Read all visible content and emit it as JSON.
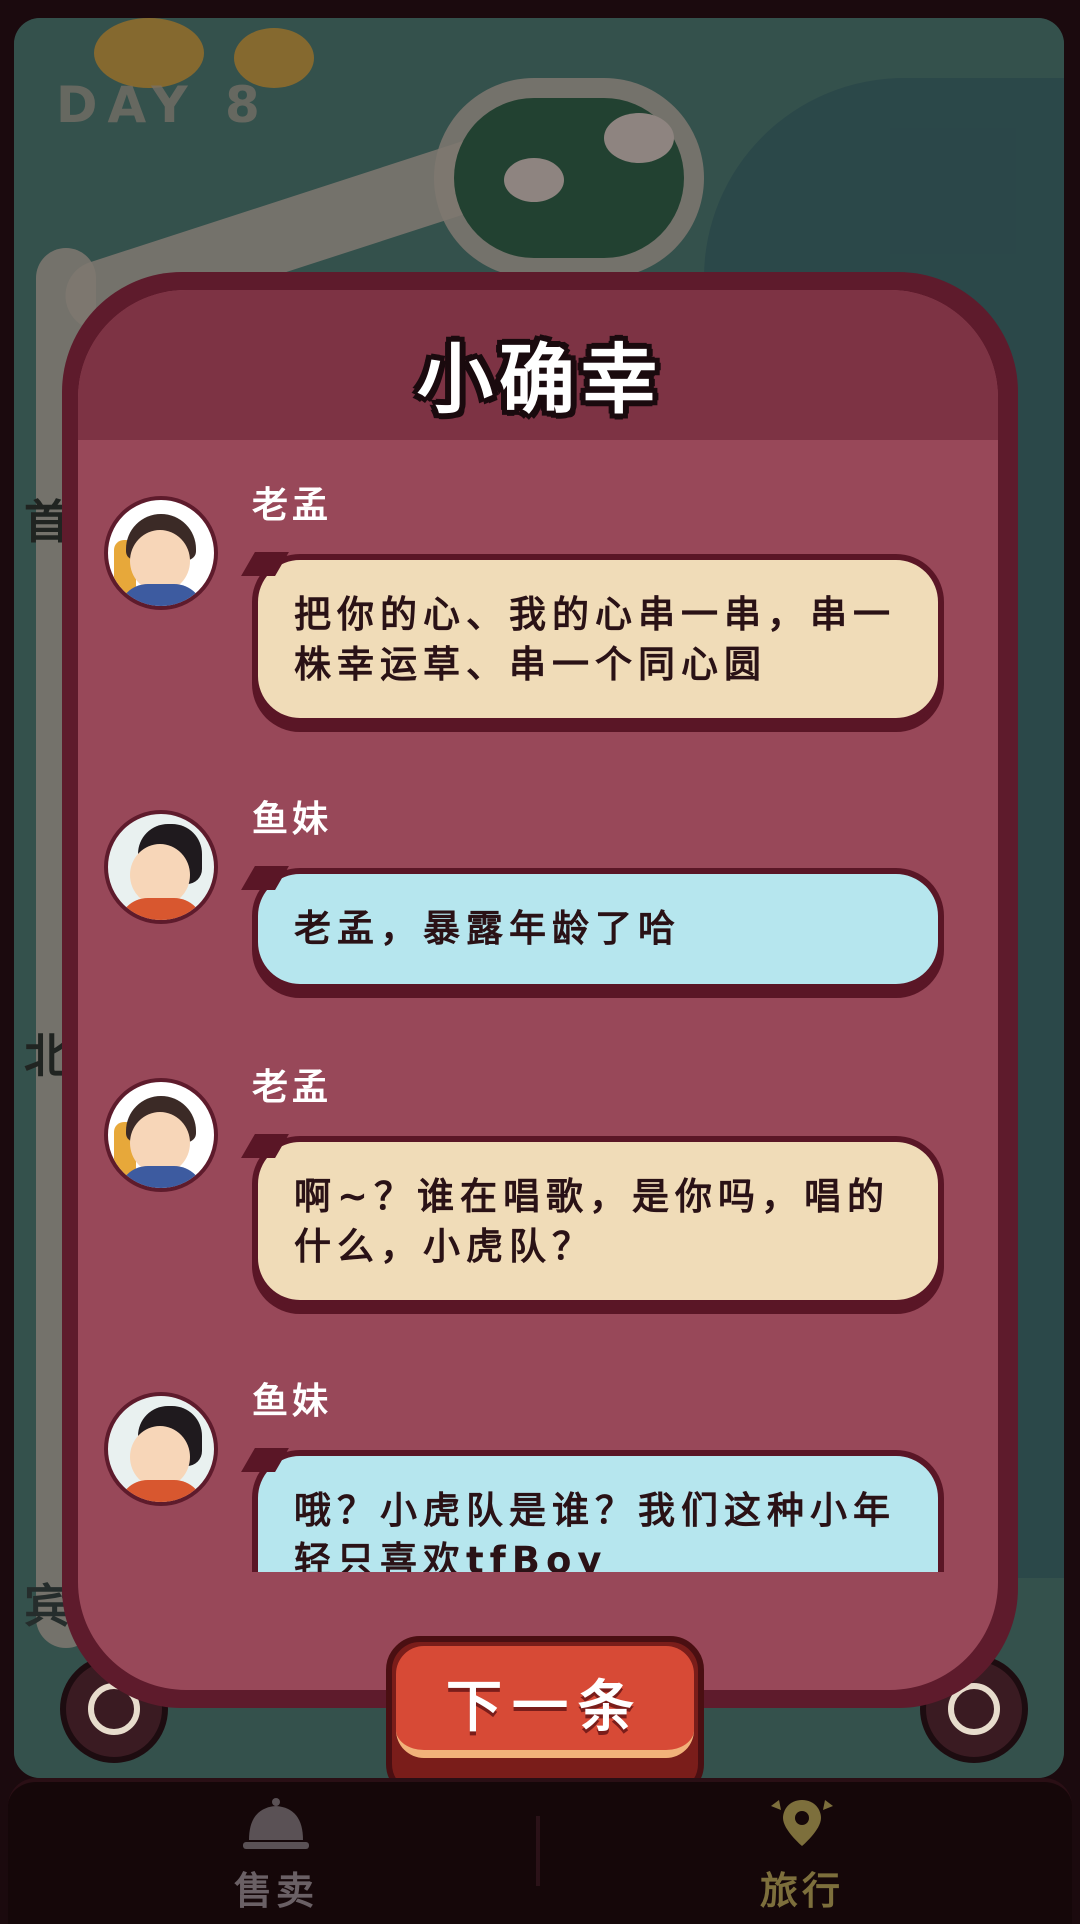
{
  "map": {
    "day_label": "DAY 8",
    "side_chars": [
      "首",
      "北",
      "宾"
    ]
  },
  "dialog": {
    "title": "小确幸",
    "messages": [
      {
        "speaker": "老孟",
        "avatar": "male-avatar",
        "style": "tan",
        "text": "把你的心、我的心串一串，串一株幸运草、串一个同心圆"
      },
      {
        "speaker": "鱼妹",
        "avatar": "female-avatar",
        "style": "blue",
        "text": "老孟，暴露年龄了哈"
      },
      {
        "speaker": "老孟",
        "avatar": "male-avatar",
        "style": "tan",
        "text": "啊~？谁在唱歌，是你吗，唱的什么，小虎队？"
      },
      {
        "speaker": "鱼妹",
        "avatar": "female-avatar",
        "style": "blue",
        "text": "哦？小虎队是谁？我们这种小年轻只喜欢tfBoy"
      }
    ],
    "next_button": "下一条"
  },
  "tabbar": {
    "sell_label": "售卖",
    "travel_label": "旅行"
  },
  "colors": {
    "panel_dark": "#5e1b2c",
    "panel_mid": "#984859",
    "bubble_tan": "#f0dcb8",
    "bubble_blue": "#b6e6ee",
    "button_red": "#d74a36",
    "tab_travel_gold": "#7d6f3c"
  }
}
